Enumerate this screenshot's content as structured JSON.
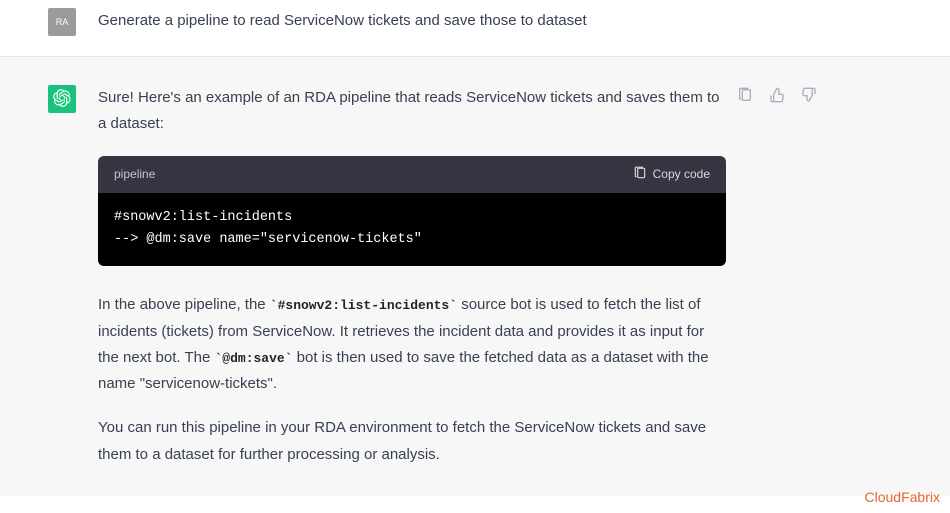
{
  "user": {
    "avatar_label": "RA",
    "message": "Generate a pipeline to read ServiceNow tickets and save those to dataset"
  },
  "assistant": {
    "intro": "Sure! Here's an example of an RDA pipeline that reads ServiceNow tickets and saves them to a dataset:",
    "code": {
      "language_label": "pipeline",
      "copy_label": "Copy code",
      "content": "#snowv2:list-incidents\n--> @dm:save name=\"servicenow-tickets\""
    },
    "explanation": {
      "p1_pre": "In the above pipeline, the ",
      "p1_code1": "`#snowv2:list-incidents`",
      "p1_mid": " source bot is used to fetch the list of incidents (tickets) from ServiceNow. It retrieves the incident data and provides it as input for the next bot. The ",
      "p1_code2": "`@dm:save`",
      "p1_post": " bot is then used to save the fetched data as a dataset with the name \"servicenow-tickets\".",
      "p2": "You can run this pipeline in your RDA environment to fetch the ServiceNow tickets and save them to a dataset for further processing or analysis."
    }
  },
  "watermark": "CloudFabrix"
}
